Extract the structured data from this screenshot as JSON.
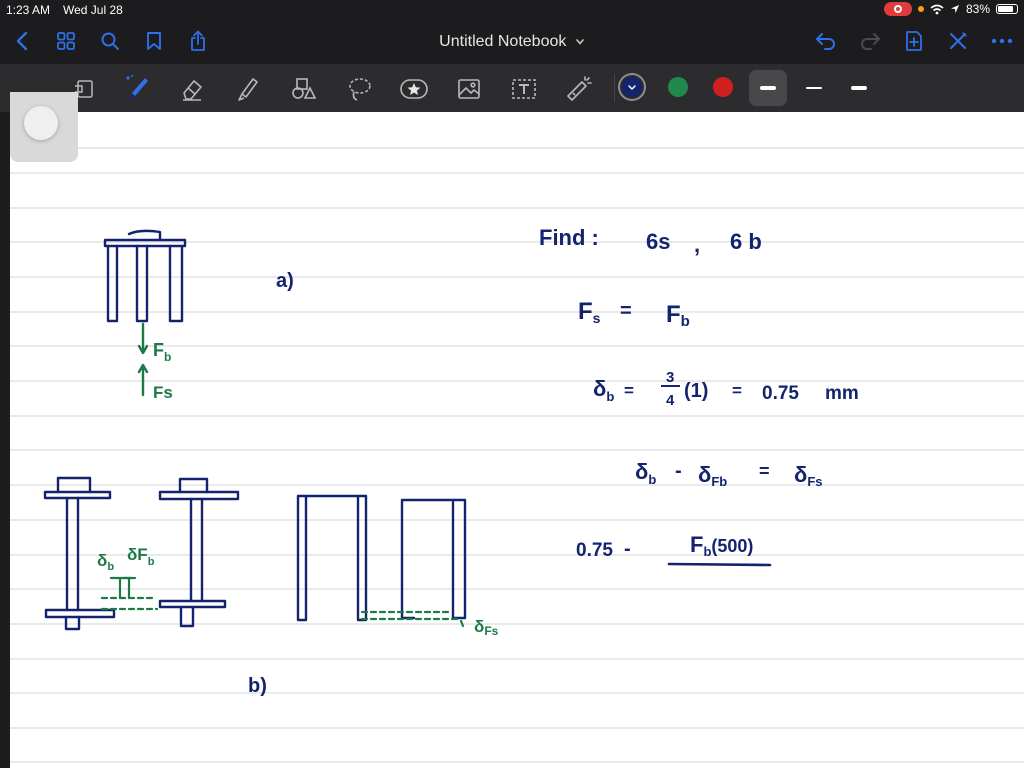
{
  "status": {
    "time": "1:23 AM",
    "date": "Wed Jul 28",
    "battery": "83%"
  },
  "nav": {
    "title": "Untitled Notebook"
  },
  "toolbar": {
    "tools": [
      "page-layout-icon",
      "pen-icon",
      "eraser-icon",
      "highlighter-icon",
      "shapes-icon",
      "lasso-icon",
      "sticker-icon",
      "image-icon",
      "text-box-icon",
      "laser-pointer-icon"
    ],
    "colors": [
      "#14236e",
      "#1f8a4c",
      "#d11f1f"
    ],
    "selected_color": "#14236e",
    "stroke_widths": [
      "thick",
      "thin",
      "medium"
    ]
  },
  "accent": "#2f6fe8",
  "ink": {
    "navy": "#14236e",
    "green": "#1e7a45"
  },
  "notes": {
    "label_a": "a)",
    "label_b": "b)",
    "arrow_fb": "F",
    "arrow_fb_sub": "b",
    "arrow_fs": "Fs",
    "find": "Find :",
    "find_s": "6s",
    "find_comma": ",",
    "find_b": "6 b",
    "eq1_left": "F",
    "eq1_left_sub": "s",
    "eq1_mid": "=",
    "eq1_right": "F",
    "eq1_right_sub": "b",
    "eq2_delta": "δ",
    "eq2_sub": "b",
    "eq2_eq": "=",
    "eq2_num": "3",
    "eq2_den": "4",
    "eq2_paren": "(1)",
    "eq2_eq2": "=",
    "eq2_value": "0.75",
    "eq2_unit": "mm",
    "eq3_a": "δ",
    "eq3_a_sub": "b",
    "eq3_minus": "-",
    "eq3_b": "δ",
    "eq3_b_sub": "Fb",
    "eq3_eq": "=",
    "eq3_c": "δ",
    "eq3_c_sub": "Fs",
    "eq4_left": "0.75",
    "eq4_minus": "-",
    "eq4_num": "F",
    "eq4_num_sub": "b",
    "eq4_num_tail": "(500)",
    "lbl_delta_b": "δ",
    "lbl_delta_b_sub": "b",
    "lbl_delta_fb": "δF",
    "lbl_delta_fb_sub": "b",
    "lbl_delta_fs": "δ",
    "lbl_delta_fs_sub": "Fs"
  }
}
